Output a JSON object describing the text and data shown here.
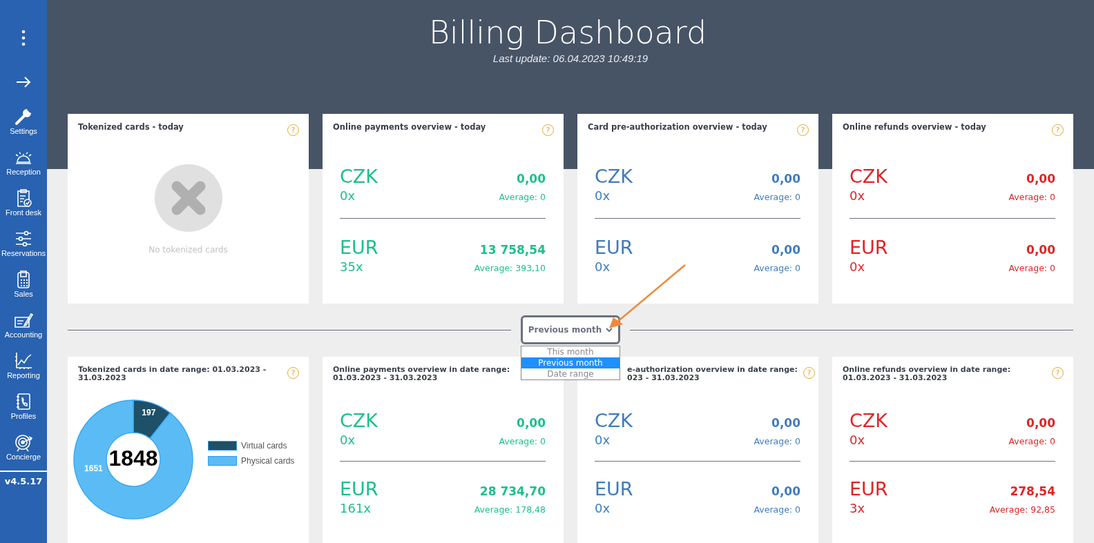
{
  "sidebar": {
    "items": [
      {
        "label": "Settings"
      },
      {
        "label": "Reception"
      },
      {
        "label": "Front desk"
      },
      {
        "label": "Reservations"
      },
      {
        "label": "Sales"
      },
      {
        "label": "Accounting"
      },
      {
        "label": "Reporting"
      },
      {
        "label": "Profiles"
      },
      {
        "label": "Concierge"
      }
    ],
    "version": "v4.5.17"
  },
  "header": {
    "title": "Billing Dashboard",
    "subtitle": "Last update: 06.04.2023 10:49:19"
  },
  "top_cards": [
    {
      "kind": "empty",
      "title": "Tokenized cards - today",
      "help": "?",
      "empty_text": "No tokenized cards"
    },
    {
      "kind": "money",
      "title": "Online payments overview - today",
      "help": "?",
      "color": "#1cc08c",
      "rows": [
        {
          "currency": "CZK",
          "amount": "0,00",
          "count": "0x",
          "average": "Average: 0"
        },
        {
          "currency": "EUR",
          "amount": "13 758,54",
          "count": "35x",
          "average": "Average: 393,10"
        }
      ]
    },
    {
      "kind": "money",
      "title": "Card pre-authorization overview - today",
      "help": "?",
      "color": "#3f7cbd",
      "rows": [
        {
          "currency": "CZK",
          "amount": "0,00",
          "count": "0x",
          "average": "Average: 0"
        },
        {
          "currency": "EUR",
          "amount": "0,00",
          "count": "0x",
          "average": "Average: 0"
        }
      ]
    },
    {
      "kind": "money",
      "title": "Online refunds overview - today",
      "help": "?",
      "color": "#e02424",
      "rows": [
        {
          "currency": "CZK",
          "amount": "0,00",
          "count": "0x",
          "average": "Average: 0"
        },
        {
          "currency": "EUR",
          "amount": "0,00",
          "count": "0x",
          "average": "Average: 0"
        }
      ]
    }
  ],
  "period_select": {
    "value": "Previous month",
    "options": [
      {
        "label": "This month",
        "selected": false
      },
      {
        "label": "Previous month",
        "selected": true
      },
      {
        "label": "Date range",
        "selected": false
      }
    ]
  },
  "bottom_cards": [
    {
      "kind": "donut",
      "title": "Tokenized cards in date range: 01.03.2023 - 31.03.2023",
      "help": "?",
      "center_label": "1848",
      "chart_data": {
        "type": "donut",
        "categories": [
          "Virtual cards",
          "Physical cards"
        ],
        "series": [
          {
            "colors": [
              "#1e5067",
              "#5bbcf5"
            ],
            "values": [
              197,
              1651
            ]
          }
        ],
        "data_labels": true
      }
    },
    {
      "kind": "money",
      "title": "Online payments overview in date range: 01.03.2023 - 31.03.2023",
      "color": "#1cc08c",
      "rows": [
        {
          "currency": "CZK",
          "amount": "0,00",
          "count": "0x",
          "average": "Average: 0"
        },
        {
          "currency": "EUR",
          "amount": "28 734,70",
          "count": "161x",
          "average": "Average: 178,48"
        }
      ]
    },
    {
      "kind": "money",
      "title_lines": [
        "e-authorization overview in date range:",
        "023 - 31.03.2023"
      ],
      "help": "?",
      "color": "#3f7cbd",
      "rows": [
        {
          "currency": "CZK",
          "amount": "0,00",
          "count": "0x",
          "average": "Average: 0"
        },
        {
          "currency": "EUR",
          "amount": "0,00",
          "count": "0x",
          "average": "Average: 0"
        }
      ]
    },
    {
      "kind": "money",
      "title": "Online refunds overview in date range: 01.03.2023 - 31.03.2023",
      "help": "?",
      "color": "#e02424",
      "rows": [
        {
          "currency": "CZK",
          "amount": "0,00",
          "count": "0x",
          "average": "Average: 0"
        },
        {
          "currency": "EUR",
          "amount": "278,54",
          "count": "3x",
          "average": "Average: 92,85"
        }
      ]
    }
  ]
}
